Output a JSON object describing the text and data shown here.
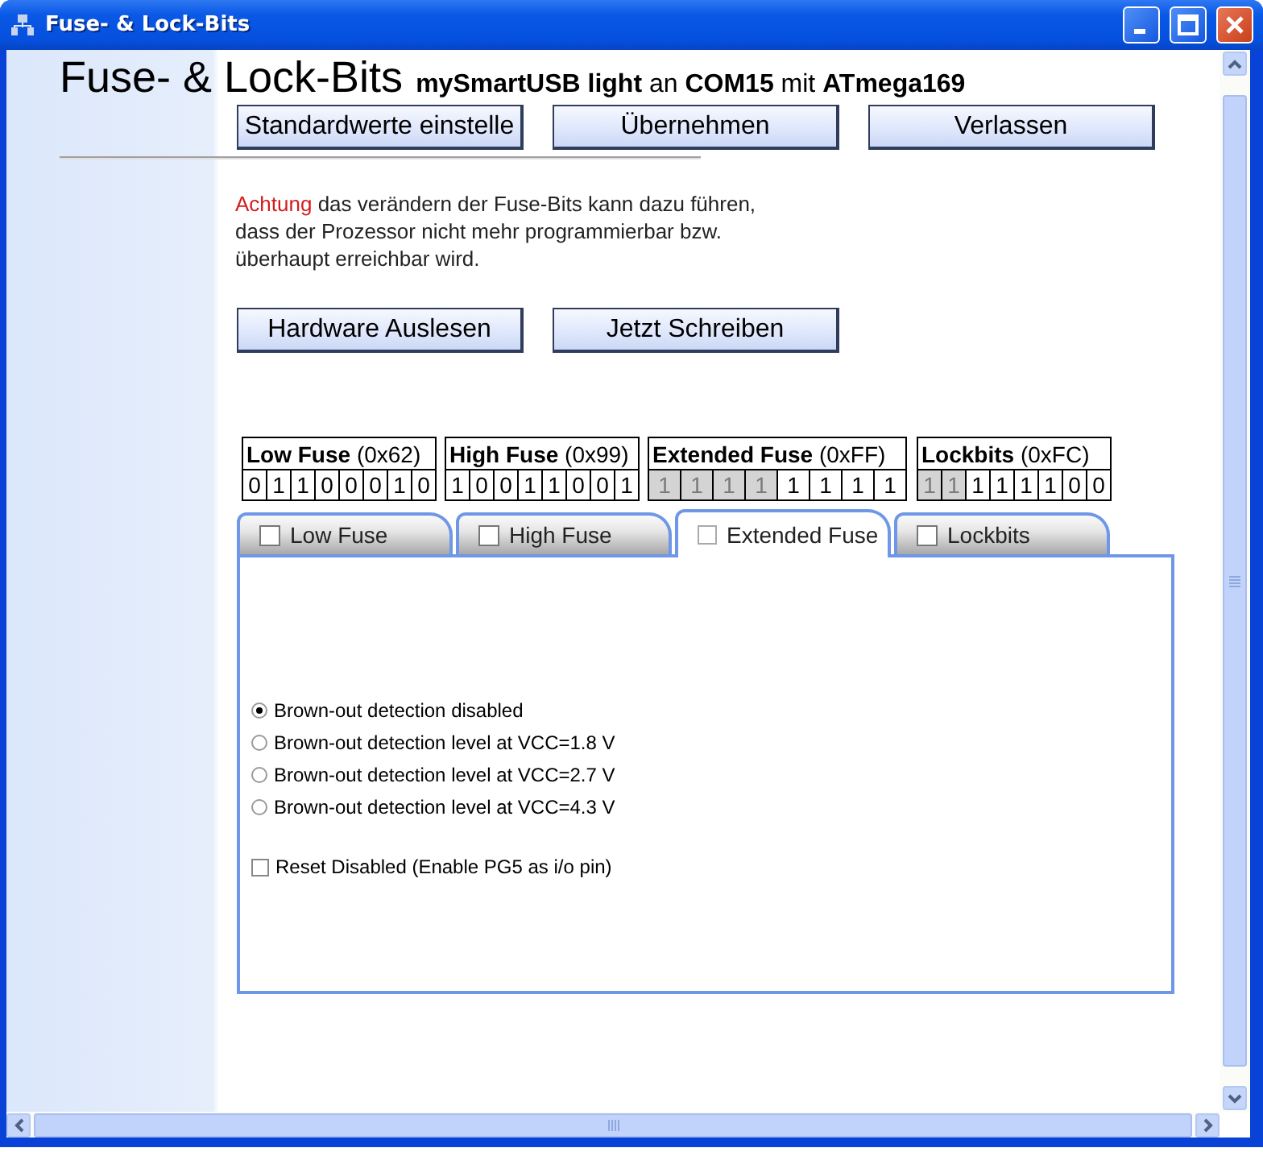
{
  "window": {
    "title": "Fuse- & Lock-Bits"
  },
  "heading": {
    "title": "Fuse- & Lock-Bits",
    "subtitle": "**mySmartUSB light** an **COM15** mit **ATmega169**"
  },
  "top_buttons": [
    "Standardwerte einstelle",
    "Übernehmen",
    "Verlassen"
  ],
  "warning": {
    "label": "Achtung",
    "text": "das verändern der Fuse-Bits kann dazu führen,\ndass der Prozessor nicht mehr programmierbar bzw.\nüberhaupt erreichbar wird."
  },
  "action_buttons": [
    "Hardware Auslesen",
    "Jetzt Schreiben"
  ],
  "fuses": [
    {
      "label": "**Low Fuse** (0x62)",
      "bits": [
        {
          "value": "0",
          "disabled": false
        },
        {
          "value": "1",
          "disabled": false
        },
        {
          "value": "1",
          "disabled": false
        },
        {
          "value": "0",
          "disabled": false
        },
        {
          "value": "0",
          "disabled": false
        },
        {
          "value": "0",
          "disabled": false
        },
        {
          "value": "1",
          "disabled": false
        },
        {
          "value": "0",
          "disabled": false
        }
      ]
    },
    {
      "label": "**High Fuse** (0x99)",
      "bits": [
        {
          "value": "1",
          "disabled": false
        },
        {
          "value": "0",
          "disabled": false
        },
        {
          "value": "0",
          "disabled": false
        },
        {
          "value": "1",
          "disabled": false
        },
        {
          "value": "1",
          "disabled": false
        },
        {
          "value": "0",
          "disabled": false
        },
        {
          "value": "0",
          "disabled": false
        },
        {
          "value": "1",
          "disabled": false
        }
      ]
    },
    {
      "label": "**Extended Fuse** (0xFF)",
      "bits": [
        {
          "value": "1",
          "disabled": true
        },
        {
          "value": "1",
          "disabled": true
        },
        {
          "value": "1",
          "disabled": true
        },
        {
          "value": "1",
          "disabled": true
        },
        {
          "value": "1",
          "disabled": false
        },
        {
          "value": "1",
          "disabled": false
        },
        {
          "value": "1",
          "disabled": false
        },
        {
          "value": "1",
          "disabled": false
        }
      ]
    },
    {
      "label": "**Lockbits** (0xFC)",
      "bits": [
        {
          "value": "1",
          "disabled": true
        },
        {
          "value": "1",
          "disabled": true
        },
        {
          "value": "1",
          "disabled": false
        },
        {
          "value": "1",
          "disabled": false
        },
        {
          "value": "1",
          "disabled": false
        },
        {
          "value": "1",
          "disabled": false
        },
        {
          "value": "0",
          "disabled": false
        },
        {
          "value": "0",
          "disabled": false
        }
      ]
    }
  ],
  "tabs": [
    {
      "label": "Low Fuse",
      "checked": false,
      "selected": false
    },
    {
      "label": "High Fuse",
      "checked": false,
      "selected": false
    },
    {
      "label": "Extended Fuse",
      "checked": false,
      "selected": true
    },
    {
      "label": "Lockbits",
      "checked": false,
      "selected": false
    }
  ],
  "options": [
    {
      "kind": "radio",
      "label": "Brown-out detection disabled",
      "checked": true
    },
    {
      "kind": "radio",
      "label": "Brown-out detection level at VCC=1.8 V",
      "checked": false
    },
    {
      "kind": "radio",
      "label": "Brown-out detection level at VCC=2.7 V",
      "checked": false
    },
    {
      "kind": "radio",
      "label": "Brown-out detection level at VCC=4.3 V",
      "checked": false
    },
    {
      "kind": "checkbox",
      "label": "Reset Disabled (Enable PG5 as i/o pin)",
      "checked": false
    }
  ]
}
